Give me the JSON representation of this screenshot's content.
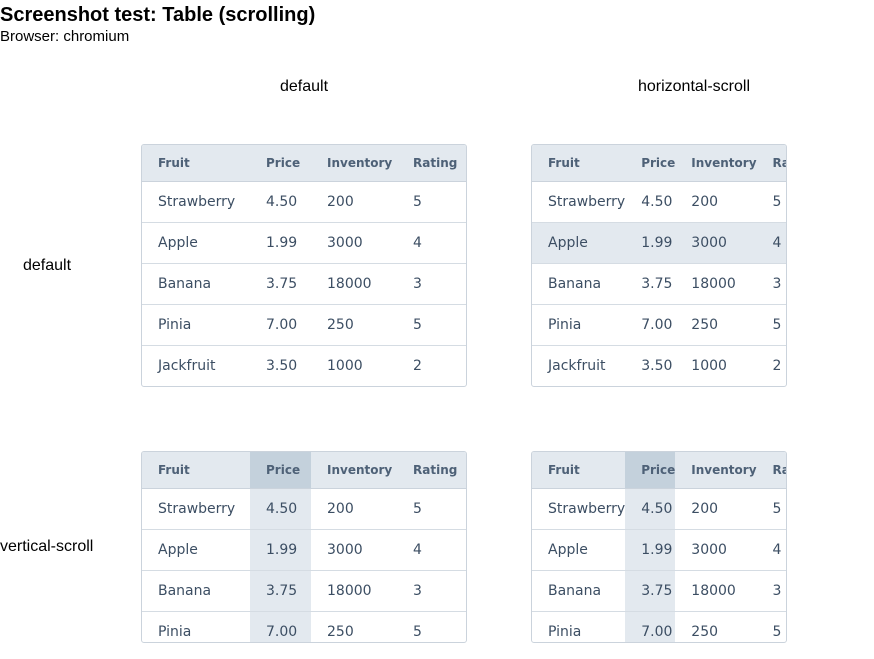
{
  "header": {
    "title": "Screenshot test: Table (scrolling)",
    "browser": "Browser: chromium"
  },
  "column_labels": [
    "default",
    "horizontal-scroll"
  ],
  "row_labels": [
    "default",
    "vertical-scroll"
  ],
  "table": {
    "headers": [
      "Fruit",
      "Price",
      "Inventory",
      "Rating"
    ],
    "rows": [
      [
        "Strawberry",
        "4.50",
        "200",
        "5"
      ],
      [
        "Apple",
        "1.99",
        "3000",
        "4"
      ],
      [
        "Banana",
        "3.75",
        "18000",
        "3"
      ],
      [
        "Pinia",
        "7.00",
        "250",
        "5"
      ],
      [
        "Jackfruit",
        "3.50",
        "1000",
        "2"
      ]
    ]
  },
  "colors": {
    "header_bg": "#e3e9ef",
    "highlighted_header_bg": "#c4d1dc",
    "highlight_bg": "#e3e9ef",
    "border": "#cbd3dc",
    "text": "#3c4e63"
  }
}
